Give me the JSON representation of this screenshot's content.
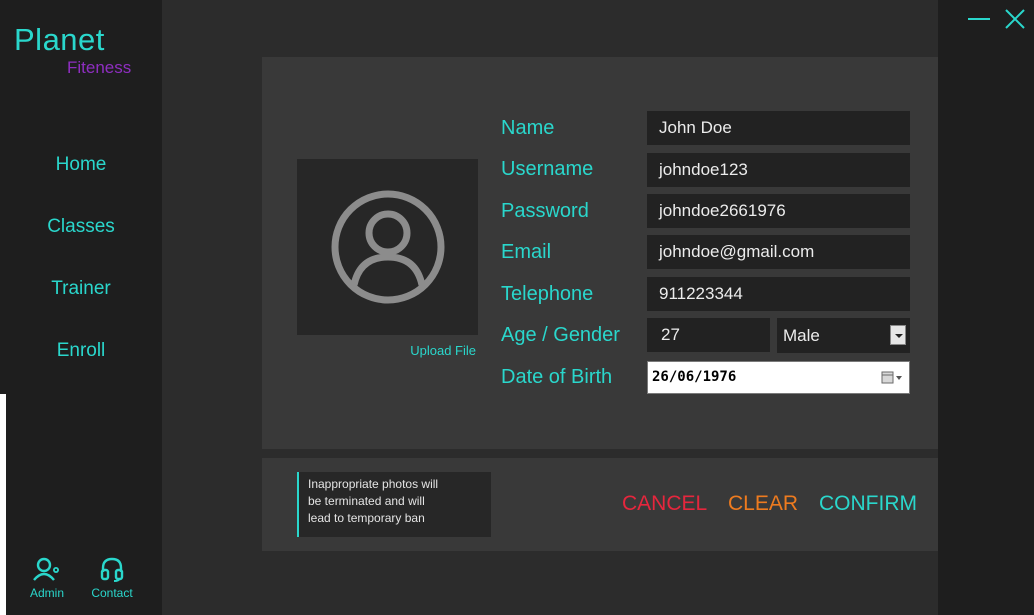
{
  "app": {
    "logo_main": "Planet",
    "logo_sub": "Fiteness"
  },
  "nav": [
    {
      "label": "Home"
    },
    {
      "label": "Classes"
    },
    {
      "label": "Trainer"
    },
    {
      "label": "Enroll"
    }
  ],
  "footer": {
    "admin_label": "Admin",
    "contact_label": "Contact"
  },
  "form": {
    "upload_label": "Upload File",
    "name_label": "Name",
    "name_value": "John Doe",
    "username_label": "Username",
    "username_value": "johndoe123",
    "password_label": "Password",
    "password_value": "johndoe2661976",
    "email_label": "Email",
    "email_value": "johndoe@gmail.com",
    "telephone_label": "Telephone",
    "telephone_value": "911223344",
    "age_gender_label": "Age / Gender",
    "age_value": "27",
    "gender_value": "Male",
    "dob_label": "Date of Birth",
    "dob_value": "26/06/1976"
  },
  "notice": {
    "line1": "Inappropriate photos will",
    "line2": "be terminated and will",
    "line3": "lead to temporary ban"
  },
  "actions": {
    "cancel": "CANCEL",
    "clear": "CLEAR",
    "confirm": "CONFIRM"
  },
  "colors": {
    "accent": "#2ad7cc",
    "brand_purple": "#8e2ec0",
    "cancel": "#e6263d",
    "clear": "#ee7b1f",
    "confirm": "#2ad7cc",
    "background": "#2c2c2c",
    "panel": "#393939"
  },
  "icons": {
    "minimize": "minimize-icon",
    "close": "close-icon",
    "avatar": "user-circle-icon",
    "admin": "user-gear-icon",
    "contact": "headset-icon",
    "calendar": "calendar-icon",
    "dropdown": "chevron-down-icon"
  }
}
